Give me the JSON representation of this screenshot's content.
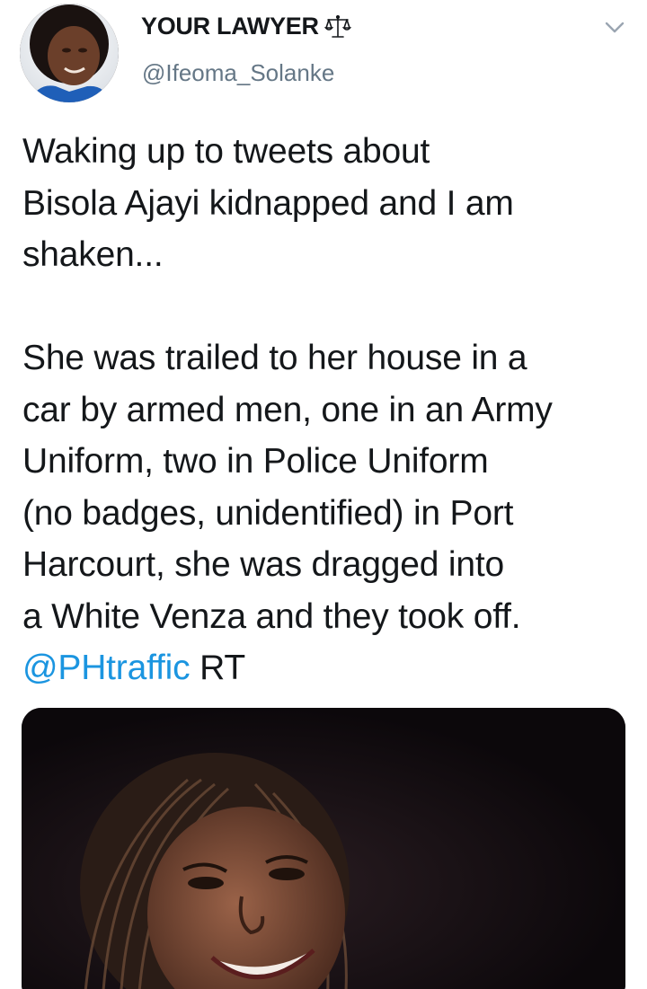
{
  "author": {
    "display_name": "YOUR LAWYER",
    "badge_icon": "balance-scale-icon",
    "handle": "@Ifeoma_Solanke",
    "avatar_icon": "profile-photo"
  },
  "menu": {
    "icon": "chevron-down-icon"
  },
  "tweet": {
    "paragraph1": [
      "Waking up to tweets about",
      "Bisola Ajayi kidnapped and I am",
      "shaken..."
    ],
    "paragraph2": [
      "She was trailed to her house in a",
      "car by armed men, one in an Army",
      "Uniform, two in Police Uniform",
      "(no badges, unidentified) in Port",
      "Harcourt, she was dragged into",
      "a White Venza and they took off."
    ],
    "mention": "@PHtraffic",
    "trailing": "RT"
  },
  "media": {
    "type": "photo",
    "subject": "smiling woman with braided hair"
  },
  "colors": {
    "link": "#1b95e0",
    "text": "#14171a",
    "secondary": "#657786",
    "media_bg": "#120d10"
  }
}
